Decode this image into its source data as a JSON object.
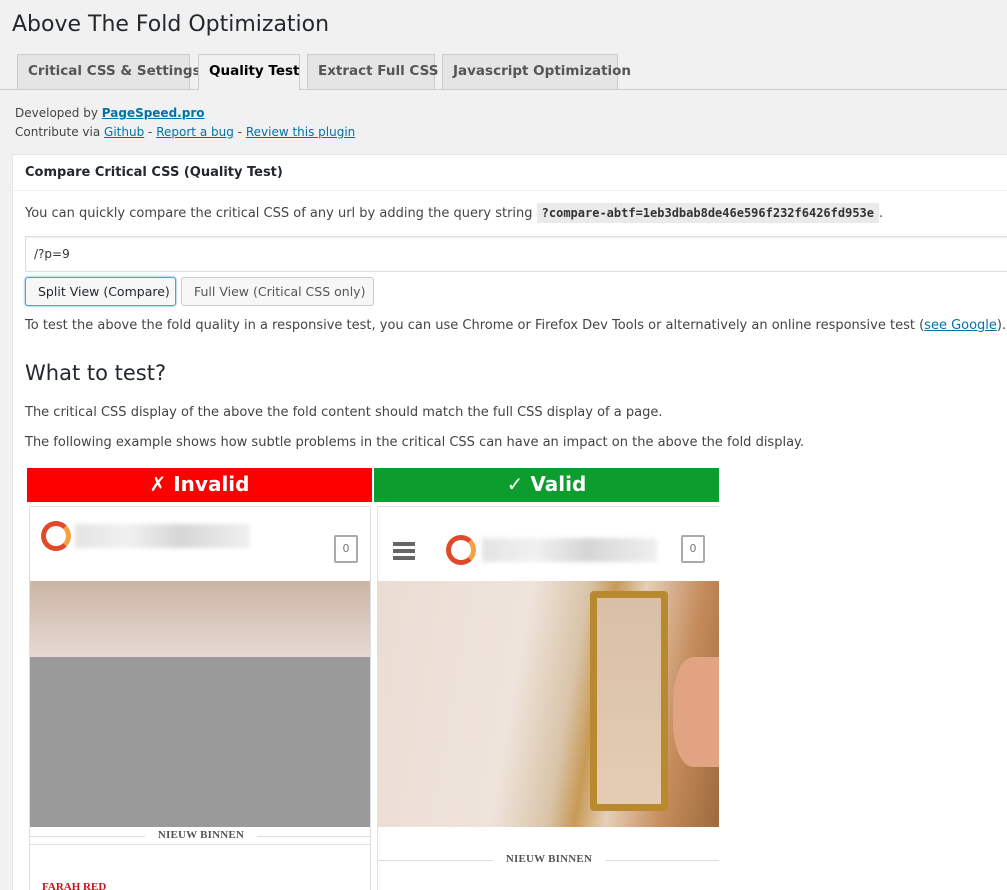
{
  "title": "Above The Fold Optimization",
  "tabs": [
    {
      "label": "Critical CSS & Settings",
      "active": false
    },
    {
      "label": "Quality Test",
      "active": true
    },
    {
      "label": "Extract Full CSS",
      "active": false
    },
    {
      "label": "Javascript Optimization",
      "active": false
    }
  ],
  "credits": {
    "developed_by": "Developed by",
    "pagespeed": "PageSpeed.pro",
    "contribute_via": "Contribute via",
    "github": "Github",
    "report_bug": "Report a bug",
    "review": "Review this plugin",
    "sep": "-"
  },
  "panel": {
    "heading": "Compare Critical CSS (Quality Test)",
    "intro": "You can quickly compare the critical CSS of any url by adding the query string",
    "query_string": "?compare-abtf=1eb3dbab8de46e596f232f6426fd953e",
    "url_value": "/?p=9",
    "split_button": "Split View (Compare)",
    "full_button": "Full View (Critical CSS only)",
    "responsive_text": "To test the above the fold quality in a responsive test, you can use Chrome or Firefox Dev Tools or alternatively an online responsive test (",
    "see_google": "see Google",
    "responsive_end": ").",
    "what_heading": "What to test?",
    "what_p1": "The critical CSS display of the above the fold content should match the full CSS display of a page.",
    "what_p2": "The following example shows how subtle problems in the critical CSS can have an impact on the above the fold display."
  },
  "demo": {
    "invalid_label": "✗ Invalid",
    "valid_label": "✓ Valid",
    "bag_count": "0",
    "new_in_label": "NIEUW BINNEN",
    "product_label": "FARAH RED",
    "invalid_color": "#ff0000",
    "valid_color": "#0d9d2e"
  }
}
